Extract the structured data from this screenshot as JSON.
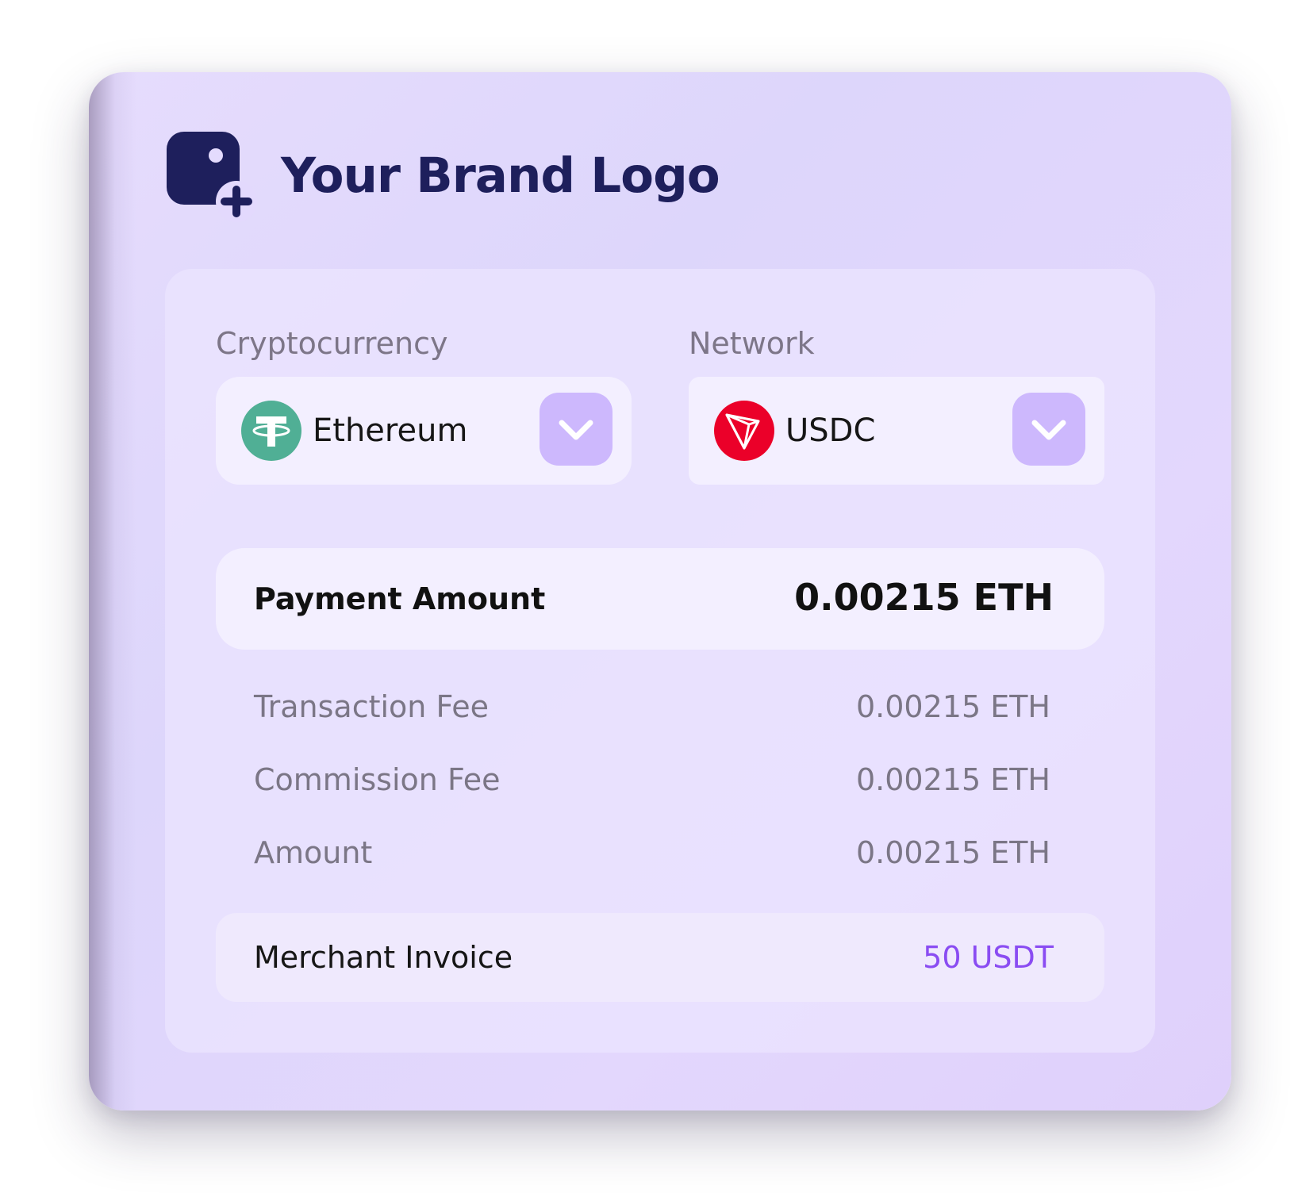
{
  "brand": {
    "name": "Your Brand Logo",
    "icon": "image-plus-icon"
  },
  "cryptocurrency": {
    "label": "Cryptocurrency",
    "selected": "Ethereum",
    "icon": "tether-icon",
    "icon_color": "#50af95"
  },
  "network": {
    "label": "Network",
    "selected": "USDC",
    "icon": "tron-icon",
    "icon_color": "#eb0029"
  },
  "payment": {
    "label": "Payment Amount",
    "value": "0.00215 ETH"
  },
  "fees": [
    {
      "label": "Transaction Fee",
      "value": "0.00215 ETH"
    },
    {
      "label": "Commission Fee",
      "value": "0.00215 ETH"
    },
    {
      "label": "Amount",
      "value": "0.00215 ETH"
    }
  ],
  "invoice": {
    "label": "Merchant Invoice",
    "value": "50 USDT",
    "value_color": "#8a4cf2"
  },
  "colors": {
    "brand_navy": "#1e1f5c",
    "dropdown_button": "#cdb8fd",
    "card_background": "#e3d9fd"
  }
}
